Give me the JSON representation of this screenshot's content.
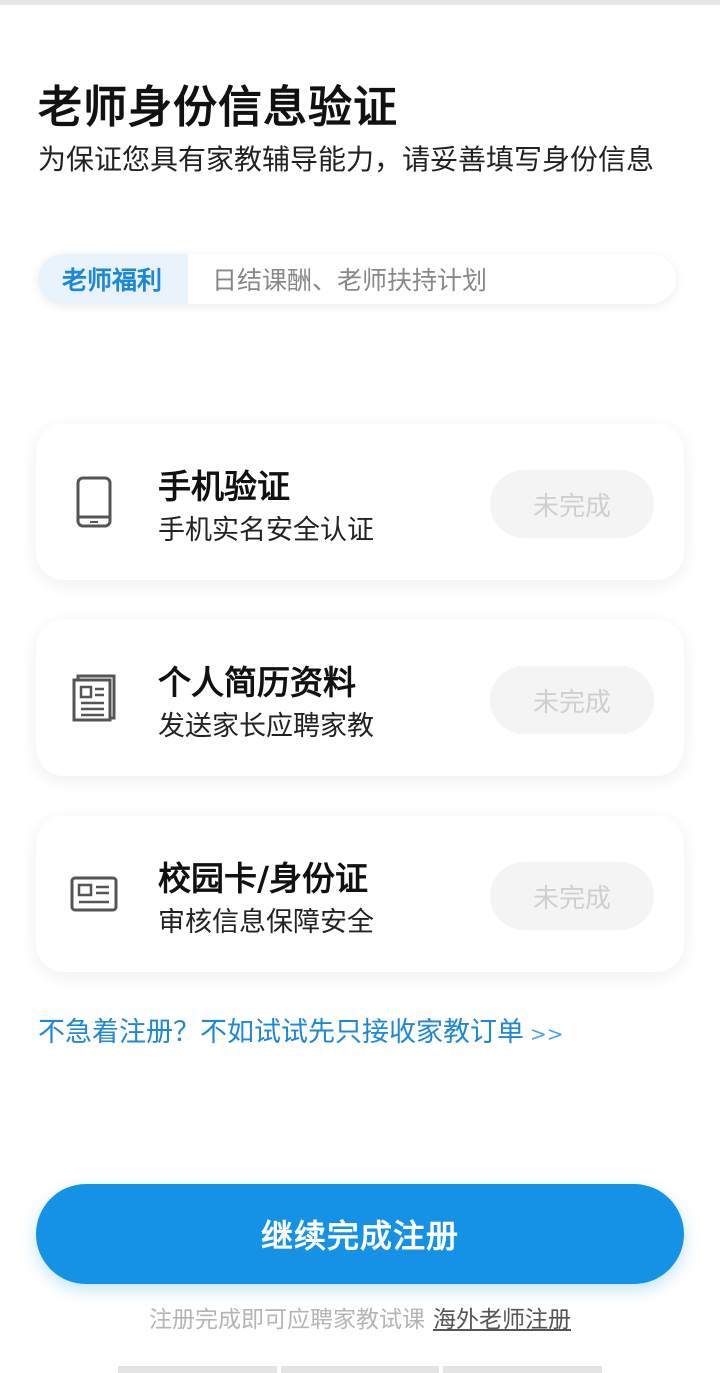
{
  "header": {
    "title": "老师身份信息验证",
    "subtitle": "为保证您具有家教辅导能力，请妥善填写身份信息"
  },
  "benefit": {
    "tag": "老师福利",
    "text": "日结课酬、老师扶持计划"
  },
  "cards": [
    {
      "icon": "phone-icon",
      "title": "手机验证",
      "desc": "手机实名安全认证",
      "status": "未完成"
    },
    {
      "icon": "document-icon",
      "title": "个人简历资料",
      "desc": "发送家长应聘家教",
      "status": "未完成"
    },
    {
      "icon": "id-card-icon",
      "title": "校园卡/身份证",
      "desc": "审核信息保障安全",
      "status": "未完成"
    }
  ],
  "try_link": {
    "text": "不急着注册？不如试试先只接收家教订单",
    "arrows": ">>"
  },
  "primary_button": "继续完成注册",
  "footer": {
    "note": "注册完成即可应聘家教试课",
    "overseas_link": "海外老师注册"
  },
  "colors": {
    "accent": "#1592e6",
    "link": "#1e88d6",
    "status_bg": "#f4f4f4",
    "status_text": "#cfcfcf"
  }
}
